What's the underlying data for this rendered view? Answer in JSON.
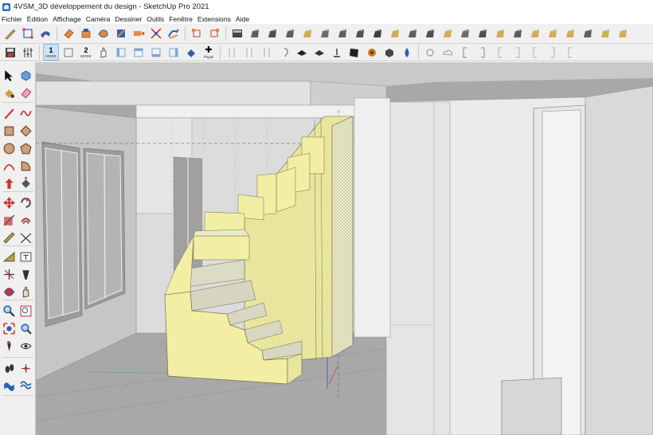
{
  "window": {
    "title": "4VSM_3D développement du design - SketchUp Pro 2021"
  },
  "menu": {
    "items": [
      "Fichier",
      "Édition",
      "Affichage",
      "Caméra",
      "Dessiner",
      "Outils",
      "Fenêtre",
      "Extensions",
      "Aide"
    ]
  },
  "toolbar2": {
    "mode1_num": "1",
    "mode1_label": "MODE",
    "mode2_num": "2",
    "mode2_label": "MODE",
    "plugin_label": "Plugin"
  },
  "colors": {
    "stair_face": "#f2efa4",
    "stair_top": "#e8e6d2",
    "viewport_bg": "#a9a9a9",
    "wall_light": "#e9e9e9"
  },
  "icons": {
    "toolbar1": [
      "pencil-tool-icon",
      "scale-tool-icon",
      "follow-me-icon",
      "eraser-icon",
      "push-pull-icon",
      "offset-icon",
      "rotate-icon",
      "move-icon",
      "intersect-icon",
      "solid-tools-icon",
      "shadow-icon",
      "section-icon",
      "component-icon"
    ],
    "left": [
      "select-icon",
      "make-component-icon",
      "paint-bucket-icon",
      "eraser-icon",
      "line-icon",
      "freehand-icon",
      "rectangle-icon",
      "rotated-rectangle-icon",
      "circle-icon",
      "polygon-icon",
      "arc-icon",
      "pie-icon",
      "push-pull-icon",
      "follow-me-icon",
      "move-icon",
      "rotate-icon",
      "scale-icon",
      "offset-icon",
      "tape-measure-icon",
      "dimension-icon",
      "protractor-icon",
      "text-icon",
      "axes-icon",
      "3d-text-icon",
      "orbit-icon",
      "pan-icon",
      "zoom-icon",
      "zoom-window-icon",
      "zoom-extents-icon",
      "previous-view-icon",
      "position-camera-icon",
      "look-around-icon",
      "walk-icon",
      "section-plane-icon",
      "sandbox-icon",
      "warehouse-icon"
    ]
  }
}
